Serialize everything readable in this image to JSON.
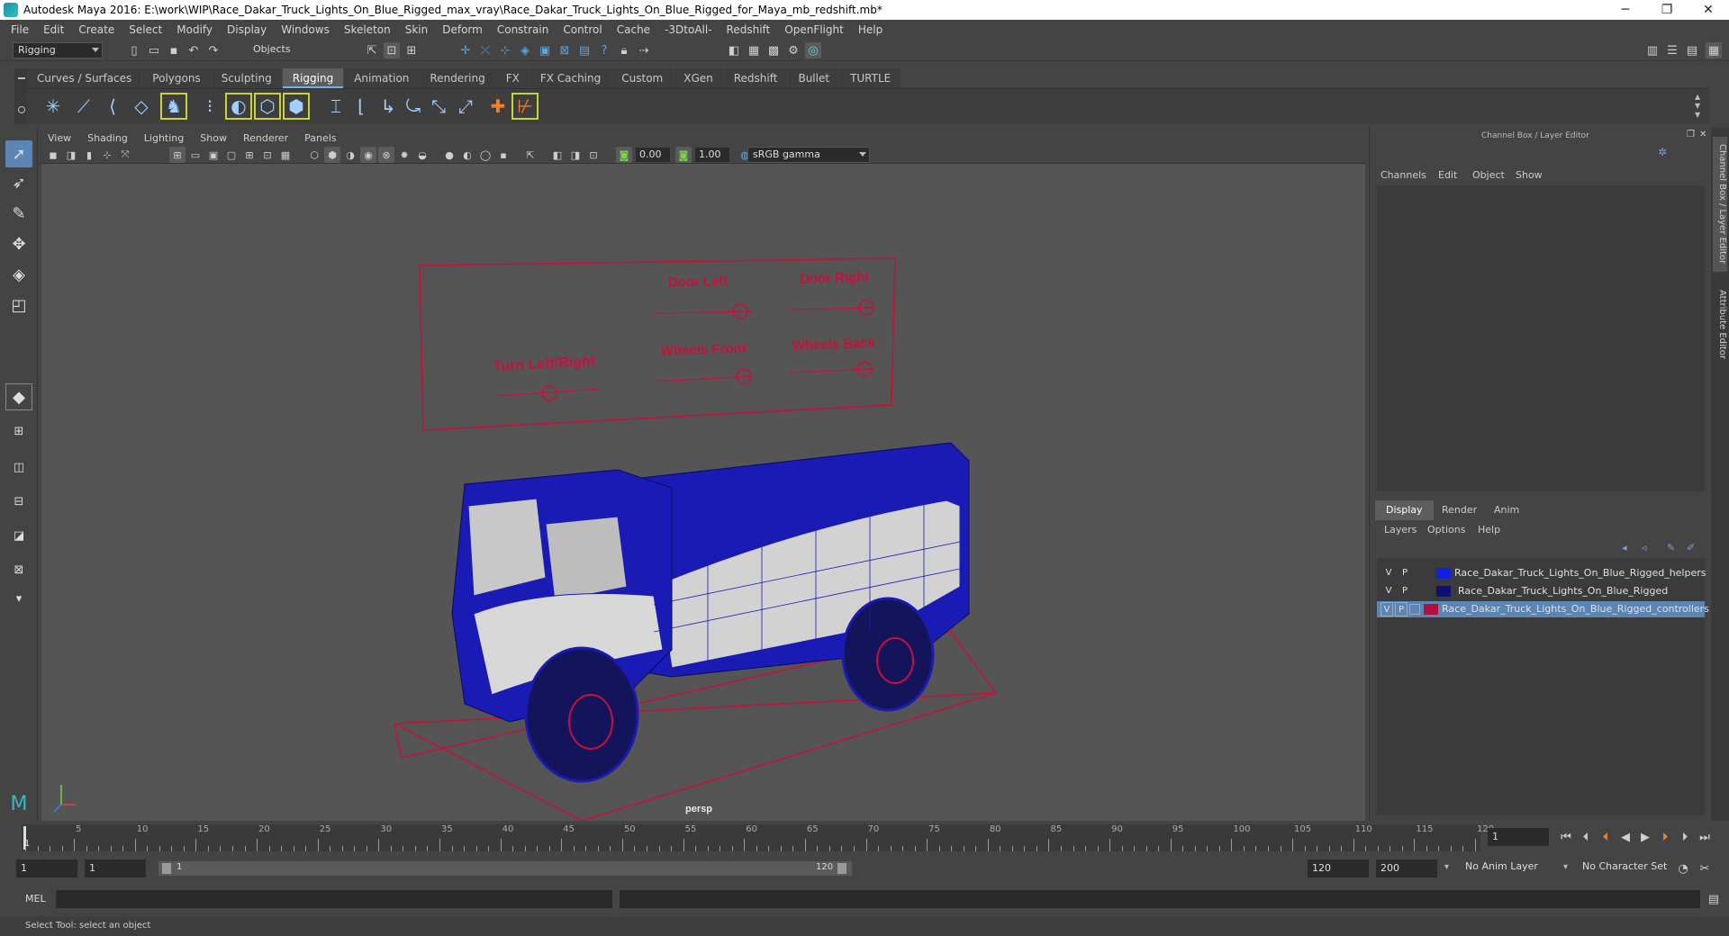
{
  "window": {
    "title": "Autodesk Maya 2016: E:\\work\\WIP\\Race_Dakar_Truck_Lights_On_Blue_Rigged_max_vray\\Race_Dakar_Truck_Lights_On_Blue_Rigged_for_Maya_mb_redshift.mb*",
    "minimize": "─",
    "maximize": "❐",
    "close": "✕"
  },
  "menubar": [
    "File",
    "Edit",
    "Create",
    "Select",
    "Modify",
    "Display",
    "Windows",
    "Skeleton",
    "Skin",
    "Deform",
    "Constrain",
    "Control",
    "Cache",
    "-3DtoAll-",
    "Redshift",
    "OpenFlight",
    "Help"
  ],
  "statusline": {
    "mode": "Rigging",
    "select_mode": "Objects"
  },
  "shelf": {
    "tabs": [
      "Curves / Surfaces",
      "Polygons",
      "Sculpting",
      "Rigging",
      "Animation",
      "Rendering",
      "FX",
      "FX Caching",
      "Custom",
      "XGen",
      "Redshift",
      "Bullet",
      "TURTLE"
    ],
    "active_tab": "Rigging"
  },
  "viewport": {
    "menu": [
      "View",
      "Shading",
      "Lighting",
      "Show",
      "Renderer",
      "Panels"
    ],
    "exposure": "0.00",
    "gamma": "1.00",
    "color_space": "sRGB gamma",
    "camera_label": "persp",
    "controller_labels": {
      "door_left": "Door Left",
      "door_right": "Door Right",
      "turn": "Turn  Left/Right",
      "wheels_front": "Wheels Front",
      "wheels_back": "Wheels Back"
    },
    "accent_color": "#c8103c",
    "mesh_color": "#1a1ab4"
  },
  "channelbox": {
    "title": "Channel Box / Layer Editor",
    "menu": [
      "Channels",
      "Edit",
      "Object",
      "Show"
    ],
    "layer_tabs": [
      "Display",
      "Render",
      "Anim"
    ],
    "active_layer_tab": "Display",
    "layer_menu": [
      "Layers",
      "Options",
      "Help"
    ],
    "layers": [
      {
        "v": "V",
        "p": "P",
        "color": "#1020e0",
        "name": "Race_Dakar_Truck_Lights_On_Blue_Rigged_helpers",
        "selected": false
      },
      {
        "v": "V",
        "p": "P",
        "color": "#101070",
        "name": "Race_Dakar_Truck_Lights_On_Blue_Rigged",
        "selected": false
      },
      {
        "v": "V",
        "p": "P",
        "color": "#b0103a",
        "name": "Race_Dakar_Truck_Lights_On_Blue_Rigged_controllers",
        "selected": true
      }
    ]
  },
  "side_tabs": [
    "Channel Box / Layer Editor",
    "Attribute Editor"
  ],
  "timeline": {
    "ticks": [
      "5",
      "10",
      "15",
      "20",
      "25",
      "30",
      "35",
      "40",
      "45",
      "50",
      "55",
      "60",
      "65",
      "70",
      "75",
      "80",
      "85",
      "90",
      "95",
      "100",
      "105",
      "110",
      "115",
      "120"
    ],
    "start_label": "1",
    "current_frame": "1"
  },
  "range": {
    "start": "1",
    "start_inner": "1",
    "slider_start": "1",
    "slider_end": "120",
    "end": "120",
    "end_outer": "200",
    "anim_layer": "No Anim Layer",
    "char_set": "No Character Set"
  },
  "cmdline": {
    "label": "MEL"
  },
  "helpline": {
    "text": "Select Tool: select an object"
  }
}
